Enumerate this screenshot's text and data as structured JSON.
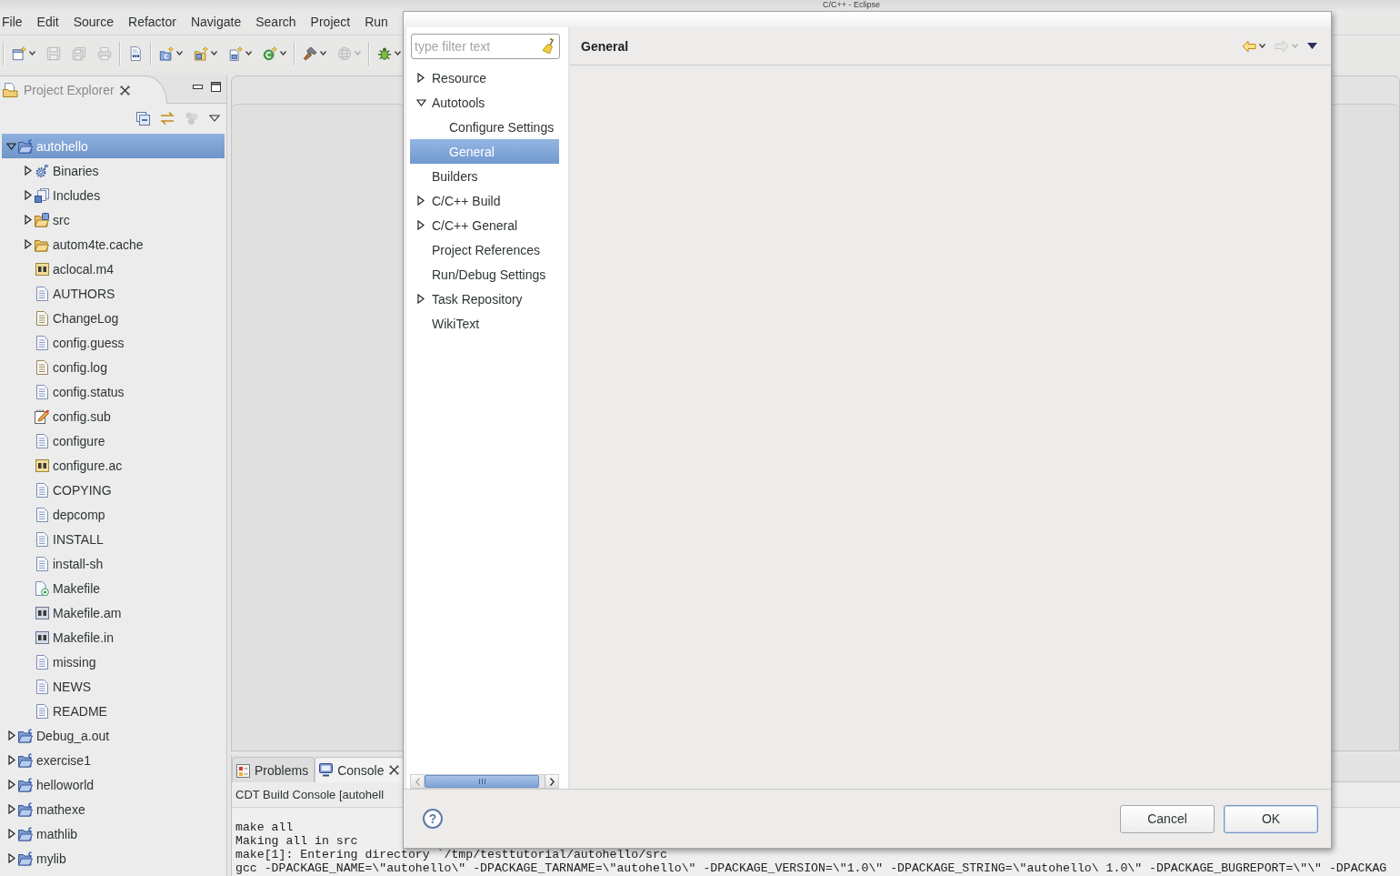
{
  "window": {
    "title": "C/C++ - Eclipse"
  },
  "menu_bar": [
    "File",
    "Edit",
    "Source",
    "Refactor",
    "Navigate",
    "Search",
    "Project",
    "Run"
  ],
  "toolbar": [
    [
      {
        "kind": "new-wizard",
        "dropdown": true,
        "disabled": false
      },
      {
        "kind": "save",
        "dropdown": false,
        "disabled": true
      },
      {
        "kind": "save-all",
        "dropdown": false,
        "disabled": true
      },
      {
        "kind": "print",
        "dropdown": false,
        "disabled": true
      }
    ],
    [
      {
        "kind": "binary",
        "dropdown": false,
        "disabled": false
      }
    ],
    [
      {
        "kind": "new-project",
        "dropdown": true,
        "disabled": false
      },
      {
        "kind": "new-folder",
        "dropdown": true,
        "disabled": false
      },
      {
        "kind": "new-file",
        "dropdown": true,
        "disabled": false
      },
      {
        "kind": "new-class",
        "dropdown": true,
        "disabled": false
      }
    ],
    [
      {
        "kind": "build",
        "dropdown": true,
        "disabled": false
      },
      {
        "kind": "globe",
        "dropdown": true,
        "disabled": true
      }
    ],
    [
      {
        "kind": "debug",
        "dropdown": true,
        "disabled": false
      }
    ]
  ],
  "project_explorer": {
    "title": "Project Explorer",
    "toolbar": [
      {
        "kind": "collapse-all",
        "disabled": false
      },
      {
        "kind": "link",
        "disabled": false
      },
      {
        "kind": "filter",
        "disabled": true
      },
      {
        "kind": "view-menu",
        "disabled": false
      }
    ],
    "tree": [
      {
        "label": "autohello",
        "kind": "project",
        "expanded": true,
        "selected": true,
        "children": [
          {
            "label": "Binaries",
            "kind": "binaries",
            "expanded": false,
            "selected": false
          },
          {
            "label": "Includes",
            "kind": "includes",
            "expanded": false,
            "selected": false
          },
          {
            "label": "src",
            "kind": "source-folder",
            "expanded": false,
            "selected": false
          },
          {
            "label": "autom4te.cache",
            "kind": "folder",
            "expanded": false,
            "selected": false
          },
          {
            "label": "aclocal.m4",
            "kind": "ac",
            "selected": false
          },
          {
            "label": "AUTHORS",
            "kind": "text",
            "selected": false
          },
          {
            "label": "ChangeLog",
            "kind": "log",
            "selected": false
          },
          {
            "label": "config.guess",
            "kind": "text",
            "selected": false
          },
          {
            "label": "config.log",
            "kind": "log",
            "selected": false
          },
          {
            "label": "config.status",
            "kind": "text",
            "selected": false
          },
          {
            "label": "config.sub",
            "kind": "edit",
            "selected": false
          },
          {
            "label": "configure",
            "kind": "text",
            "selected": false
          },
          {
            "label": "configure.ac",
            "kind": "ac",
            "selected": false
          },
          {
            "label": "COPYING",
            "kind": "text",
            "selected": false
          },
          {
            "label": "depcomp",
            "kind": "text",
            "selected": false
          },
          {
            "label": "INSTALL",
            "kind": "text",
            "selected": false
          },
          {
            "label": "install-sh",
            "kind": "text",
            "selected": false
          },
          {
            "label": "Makefile",
            "kind": "makefile",
            "selected": false
          },
          {
            "label": "Makefile.am",
            "kind": "am",
            "selected": false
          },
          {
            "label": "Makefile.in",
            "kind": "am",
            "selected": false
          },
          {
            "label": "missing",
            "kind": "text",
            "selected": false
          },
          {
            "label": "NEWS",
            "kind": "text",
            "selected": false
          },
          {
            "label": "README",
            "kind": "text",
            "selected": false
          }
        ]
      },
      {
        "label": "Debug_a.out",
        "kind": "project",
        "expanded": false,
        "selected": false
      },
      {
        "label": "exercise1",
        "kind": "project",
        "expanded": false,
        "selected": false
      },
      {
        "label": "helloworld",
        "kind": "project",
        "expanded": false,
        "selected": false
      },
      {
        "label": "mathexe",
        "kind": "project",
        "expanded": false,
        "selected": false
      },
      {
        "label": "mathlib",
        "kind": "project",
        "expanded": false,
        "selected": false
      },
      {
        "label": "mylib",
        "kind": "project",
        "expanded": false,
        "selected": false
      }
    ]
  },
  "bottom_panel": {
    "tabs": [
      {
        "label": "Problems",
        "kind": "problems",
        "selected": false
      },
      {
        "label": "Console",
        "kind": "console",
        "selected": true
      }
    ],
    "console_title": "CDT Build Console [autohell",
    "console_lines": [
      "make all",
      "Making all in src",
      "make[1]: Entering directory `/tmp/testtutorial/autohello/src",
      "gcc -DPACKAGE_NAME=\\\"autohello\\\" -DPACKAGE_TARNAME=\\\"autohello\\\" -DPACKAGE_VERSION=\\\"1.0\\\" -DPACKAGE_STRING=\\\"autohello\\ 1.0\\\" -DPACKAGE_BUGREPORT=\\\"\\\" -DPACKAG"
    ]
  },
  "dialog": {
    "filter": {
      "placeholder": "type filter text"
    },
    "pages": [
      {
        "label": "Resource",
        "expanded": false,
        "selected": false
      },
      {
        "label": "Autotools",
        "expanded": true,
        "selected": false,
        "children": [
          {
            "label": "Configure Settings",
            "selected": false
          },
          {
            "label": "General",
            "selected": true
          }
        ]
      },
      {
        "label": "Builders",
        "selected": false
      },
      {
        "label": "C/C++ Build",
        "expanded": false,
        "selected": false
      },
      {
        "label": "C/C++ General",
        "expanded": false,
        "selected": false
      },
      {
        "label": "Project References",
        "selected": false
      },
      {
        "label": "Run/Debug Settings",
        "selected": false
      },
      {
        "label": "Task Repository",
        "expanded": false,
        "selected": false
      },
      {
        "label": "WikiText",
        "selected": false
      }
    ],
    "page_title": "General",
    "nav": [
      {
        "kind": "back",
        "dropdown": true,
        "disabled": false
      },
      {
        "kind": "forward",
        "dropdown": true,
        "disabled": true
      },
      {
        "kind": "view-menu",
        "dropdown": false,
        "disabled": false
      }
    ],
    "help": "?",
    "buttons": [
      {
        "label": "Cancel",
        "default": false
      },
      {
        "label": "OK",
        "default": true
      }
    ]
  }
}
